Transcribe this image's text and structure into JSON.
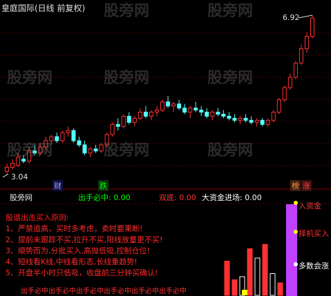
{
  "header": {
    "title": "皇庭国际(日线 前复权)"
  },
  "watermark": "股旁网",
  "price_labels": {
    "high": "6.92",
    "low": "3.04"
  },
  "event_tags": {
    "cai": "财",
    "die": "跌",
    "bang": "榜",
    "zhang": "涨"
  },
  "indicator": {
    "name": "股旁网",
    "l1_text": "出手必中: 0.00",
    "l2_text": "双底: 0.00",
    "l3_text": "大资金进场: 0.00",
    "rules_title": "股谱出击买入原则:",
    "rules": [
      "1、严禁追高，买时多考虑，卖时要果断!",
      "2、提前未跟踪不买,拉升不买,阳线放量更不买!",
      "3、顺势而为,分批买入,高抛低吸,控制仓位!",
      "4、短线看K线,中线看形态,长线重趋势!",
      "5、开盘半小时只低吸，收盘前三分钟买确认!"
    ],
    "right_labels": [
      "入资金",
      "择机买入",
      "多数会涨"
    ],
    "bottom_text": "出手必中出手必中出手必中出手必中出手必中出手必中"
  },
  "colors": {
    "up": "#ff3232",
    "down": "#54ffff",
    "magenta": "#c040ff",
    "yellow": "#ffff00"
  },
  "candles": [
    [
      3.1,
      3.3,
      3.04,
      3.2
    ],
    [
      3.2,
      3.4,
      3.15,
      3.3
    ],
    [
      3.25,
      3.55,
      3.2,
      3.45
    ],
    [
      3.4,
      3.5,
      3.3,
      3.35
    ],
    [
      3.35,
      3.7,
      3.3,
      3.6
    ],
    [
      3.6,
      3.75,
      3.5,
      3.55
    ],
    [
      3.55,
      3.8,
      3.5,
      3.7
    ],
    [
      3.7,
      3.95,
      3.6,
      3.85
    ],
    [
      3.85,
      4.0,
      3.75,
      3.95
    ],
    [
      3.95,
      4.05,
      3.8,
      3.85
    ],
    [
      3.85,
      4.1,
      3.8,
      4.05
    ],
    [
      4.05,
      4.2,
      3.95,
      4.1
    ],
    [
      4.1,
      4.15,
      3.8,
      3.85
    ],
    [
      3.85,
      3.95,
      3.7,
      3.75
    ],
    [
      3.75,
      3.85,
      3.5,
      3.55
    ],
    [
      3.55,
      3.7,
      3.45,
      3.65
    ],
    [
      3.65,
      3.75,
      3.55,
      3.6
    ],
    [
      3.6,
      3.8,
      3.55,
      3.75
    ],
    [
      3.75,
      4.05,
      3.7,
      4.0
    ],
    [
      4.0,
      4.3,
      3.95,
      4.25
    ],
    [
      4.25,
      4.4,
      4.1,
      4.2
    ],
    [
      4.2,
      4.5,
      4.15,
      4.45
    ],
    [
      4.45,
      4.55,
      4.25,
      4.3
    ],
    [
      4.3,
      4.45,
      4.2,
      4.4
    ],
    [
      4.4,
      4.65,
      4.35,
      4.55
    ],
    [
      4.55,
      4.7,
      4.4,
      4.45
    ],
    [
      4.45,
      4.6,
      4.35,
      4.55
    ],
    [
      4.55,
      4.7,
      4.45,
      4.6
    ],
    [
      4.6,
      4.85,
      4.55,
      4.8
    ],
    [
      4.8,
      4.95,
      4.65,
      4.7
    ],
    [
      4.7,
      4.8,
      4.55,
      4.75
    ],
    [
      4.75,
      4.85,
      4.6,
      4.65
    ],
    [
      4.65,
      4.75,
      4.5,
      4.55
    ],
    [
      4.55,
      4.7,
      4.4,
      4.65
    ],
    [
      4.65,
      4.8,
      4.55,
      4.6
    ],
    [
      4.6,
      4.7,
      4.45,
      4.55
    ],
    [
      4.55,
      4.65,
      4.4,
      4.45
    ],
    [
      4.45,
      4.6,
      4.35,
      4.55
    ],
    [
      4.55,
      4.65,
      4.45,
      4.5
    ],
    [
      4.5,
      4.6,
      4.4,
      4.45
    ],
    [
      4.45,
      4.55,
      4.35,
      4.4
    ],
    [
      4.4,
      4.5,
      4.3,
      4.35
    ],
    [
      4.35,
      4.45,
      4.25,
      4.4
    ],
    [
      4.4,
      4.5,
      4.3,
      4.35
    ],
    [
      4.35,
      4.45,
      4.25,
      4.3
    ],
    [
      4.3,
      4.4,
      4.2,
      4.35
    ],
    [
      4.35,
      4.4,
      4.2,
      4.25
    ],
    [
      4.25,
      4.4,
      4.2,
      4.35
    ],
    [
      4.35,
      4.6,
      4.3,
      4.55
    ],
    [
      4.55,
      4.9,
      4.5,
      4.85
    ],
    [
      4.85,
      5.2,
      4.8,
      5.15
    ],
    [
      5.15,
      5.5,
      5.1,
      5.4
    ],
    [
      5.4,
      5.8,
      5.35,
      5.75
    ],
    [
      5.75,
      6.2,
      5.7,
      6.1
    ],
    [
      6.1,
      6.5,
      6.0,
      6.4
    ],
    [
      6.4,
      6.92,
      6.35,
      6.85
    ]
  ],
  "volumes": [
    {
      "h": 0.55,
      "c": "#ff3232"
    },
    {
      "h": 0.25,
      "c": "#ff3232"
    },
    {
      "h": 0.3,
      "c": "#ffffff"
    },
    {
      "h": 0.75,
      "c": "#ff3232"
    },
    {
      "h": 0.6,
      "c": "#ffffff"
    },
    {
      "h": 0.82,
      "c": "#ff3232"
    },
    {
      "h": 0.35,
      "c": "#ffffff"
    },
    {
      "h": 0.2,
      "c": "#ff3232"
    }
  ]
}
